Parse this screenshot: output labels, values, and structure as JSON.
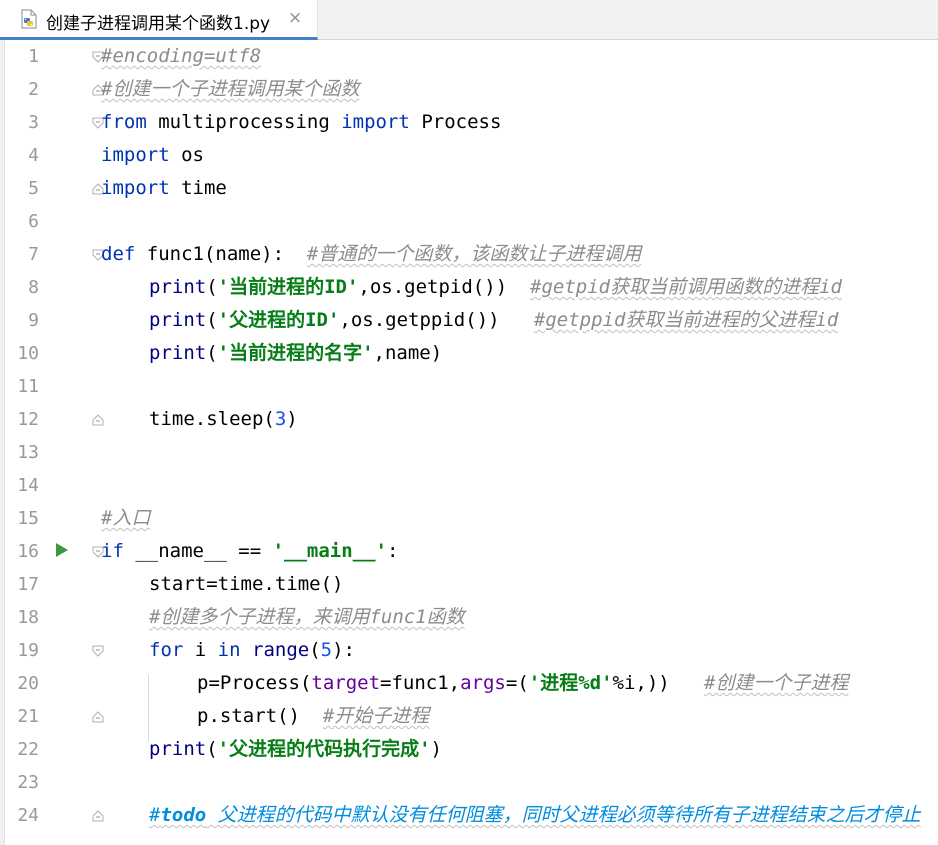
{
  "tab": {
    "title": "创建子进程调用某个函数1.py",
    "close": "×",
    "icon": "python-file-icon"
  },
  "editor": {
    "line_numbers": [
      "1",
      "2",
      "3",
      "4",
      "5",
      "6",
      "7",
      "8",
      "9",
      "10",
      "11",
      "12",
      "13",
      "14",
      "15",
      "16",
      "17",
      "18",
      "19",
      "20",
      "21",
      "22",
      "23",
      "24"
    ],
    "code": {
      "l1": {
        "comment": "#encoding=utf8"
      },
      "l2": {
        "comment": "#创建一个子进程调用某个函数"
      },
      "l3": {
        "kw1": "from",
        "mod": " multiprocessing ",
        "kw2": "import",
        "name": " Process"
      },
      "l4": {
        "kw": "import",
        "rest": " os"
      },
      "l5": {
        "kw": "import",
        "rest": " time"
      },
      "l7": {
        "kw": "def",
        "sig": " func1(name):  ",
        "comment": "#普通的一个函数，该函数让子进程调用"
      },
      "l8": {
        "fn": "print",
        "p1": "(",
        "str": "'当前进程的ID'",
        "rest": ",os.getpid())  ",
        "comment": "#getpid获取当前调用函数的进程id"
      },
      "l9": {
        "fn": "print",
        "p1": "(",
        "str": "'父进程的ID'",
        "rest": ",os.getppid())   ",
        "comment": "#getppid获取当前进程的父进程id"
      },
      "l10": {
        "fn": "print",
        "p1": "(",
        "str": "'当前进程的名字'",
        "rest": ",name)"
      },
      "l12": {
        "pre": "time.sleep(",
        "num": "3",
        "post": ")"
      },
      "l15": {
        "comment": "#入口"
      },
      "l16": {
        "kw": "if",
        "mid": " __name__ == ",
        "str": "'__main__'",
        "post": ":"
      },
      "l17": {
        "text": "start=time.time()"
      },
      "l18": {
        "comment": "#创建多个子进程，来调用func1函数"
      },
      "l19": {
        "kw1": "for",
        "mid": " i ",
        "kw2": "in",
        "sp": " ",
        "fn": "range",
        "p1": "(",
        "num": "5",
        "post": "):"
      },
      "l20": {
        "pre": "p=Process(",
        "par1": "target",
        "mid": "=func1,",
        "par2": "args",
        "mid2": "=(",
        "str": "'进程%d'",
        "post": "%i,))   ",
        "comment": "#创建一个子进程"
      },
      "l21": {
        "text": "p.start()  ",
        "comment": "#开始子进程"
      },
      "l22": {
        "fn": "print",
        "p1": "(",
        "str": "'父进程的代码执行完成'",
        "post": ")"
      },
      "l24": {
        "hash": "#",
        "todo": "todo",
        "text": " 父进程的代码中默认没有任何阻塞，同时父进程必须等待所有子进程结束之后才停止"
      }
    }
  },
  "colors": {
    "keyword": "#0033b3",
    "string": "#067d17",
    "number": "#1750eb",
    "comment": "#8c8c8c",
    "todo": "#008dde",
    "param": "#660099",
    "run_marker": "#3b9a3b",
    "tab_underline": "#4083c9"
  }
}
